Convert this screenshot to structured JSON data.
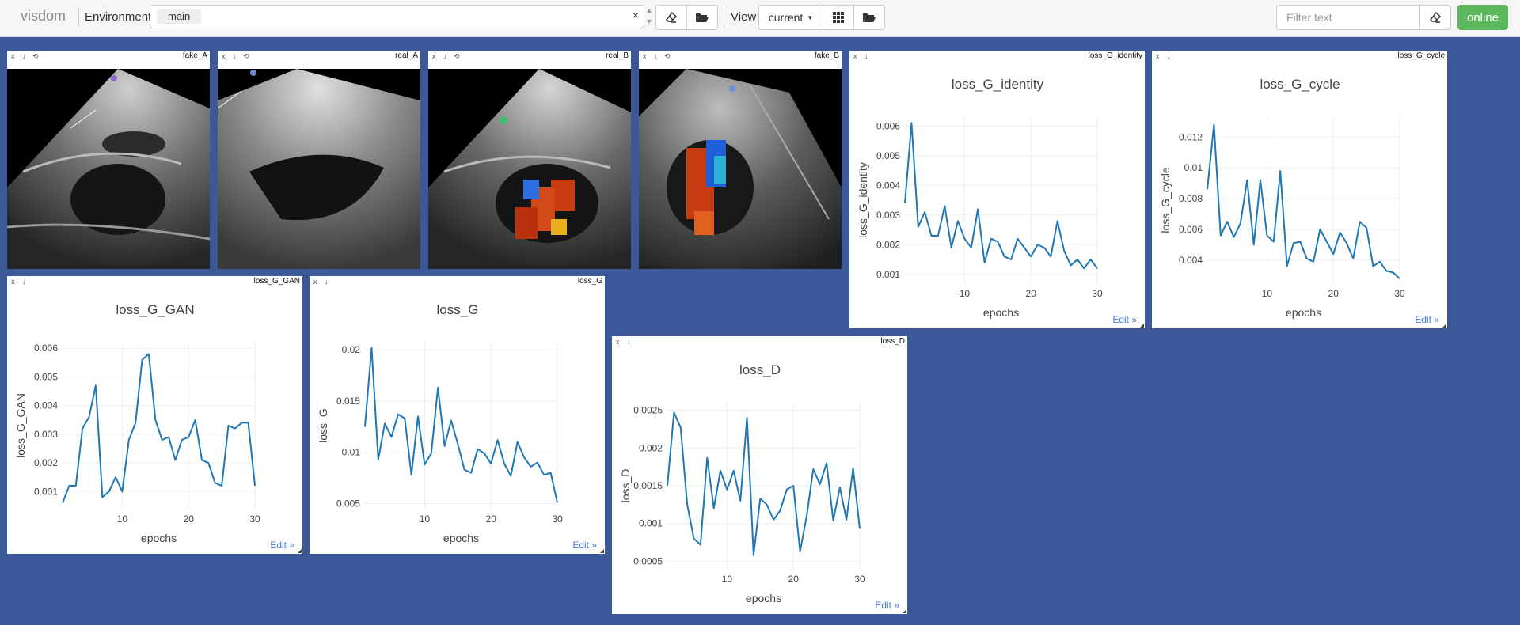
{
  "navbar": {
    "brand": "visdom",
    "environment_label": "Environment",
    "environment_tag": "main",
    "environment_clear": "×",
    "view_label": "View",
    "view_value": "current",
    "filter_placeholder": "Filter text",
    "status": "online",
    "status_color": "#5cb85c"
  },
  "pane_controls": {
    "close": "x",
    "download": "↓",
    "reset": "⟲"
  },
  "image_panes": [
    {
      "title": "fake_A",
      "kind": "grayscale-ultrasound"
    },
    {
      "title": "real_A",
      "kind": "grayscale-ultrasound"
    },
    {
      "title": "real_B",
      "kind": "color-doppler-ultrasound"
    },
    {
      "title": "fake_B",
      "kind": "color-doppler-ultrasound"
    }
  ],
  "edit_label": "Edit »",
  "chart_data": [
    {
      "type": "line",
      "title": "loss_G_identity",
      "xlabel": "epochs",
      "ylabel": "loss_G_identity",
      "line_color": "#1f77b4",
      "x": [
        1,
        2,
        3,
        4,
        5,
        6,
        7,
        8,
        9,
        10,
        11,
        12,
        13,
        14,
        15,
        16,
        17,
        18,
        19,
        20,
        21,
        22,
        23,
        24,
        25,
        26,
        27,
        28,
        29,
        30
      ],
      "y": [
        0.0034,
        0.0061,
        0.0026,
        0.0031,
        0.0023,
        0.0023,
        0.0033,
        0.0019,
        0.0028,
        0.0022,
        0.0019,
        0.0032,
        0.0014,
        0.0022,
        0.0021,
        0.0016,
        0.0015,
        0.0022,
        0.0019,
        0.0016,
        0.002,
        0.0019,
        0.0016,
        0.0028,
        0.0018,
        0.0013,
        0.0015,
        0.0012,
        0.0015,
        0.0012
      ],
      "xticks": [
        10,
        20,
        30
      ],
      "yticks": [
        0.001,
        0.002,
        0.003,
        0.004,
        0.005,
        0.006
      ],
      "ytick_labels": [
        "0.001",
        "0.002",
        "0.003",
        "0.004",
        "0.005",
        "0.006"
      ],
      "xlim": [
        1,
        30
      ],
      "ylim": [
        0.0007,
        0.0063
      ],
      "grid": true
    },
    {
      "type": "line",
      "title": "loss_G_cycle",
      "xlabel": "epochs",
      "ylabel": "loss_G_cycle",
      "line_color": "#1f77b4",
      "x": [
        1,
        2,
        3,
        4,
        5,
        6,
        7,
        8,
        9,
        10,
        11,
        12,
        13,
        14,
        15,
        16,
        17,
        18,
        19,
        20,
        21,
        22,
        23,
        24,
        25,
        26,
        27,
        28,
        29,
        30
      ],
      "y": [
        0.0086,
        0.0128,
        0.0056,
        0.0065,
        0.0055,
        0.0064,
        0.0092,
        0.005,
        0.0092,
        0.0056,
        0.0052,
        0.0098,
        0.0036,
        0.0051,
        0.0052,
        0.0041,
        0.0039,
        0.006,
        0.0052,
        0.0044,
        0.0058,
        0.0051,
        0.0041,
        0.0065,
        0.0061,
        0.0036,
        0.0039,
        0.0033,
        0.0032,
        0.0028
      ],
      "xticks": [
        10,
        20,
        30
      ],
      "yticks": [
        0.004,
        0.006,
        0.008,
        0.01,
        0.012
      ],
      "ytick_labels": [
        "0.004",
        "0.006",
        "0.008",
        "0.01",
        "0.012"
      ],
      "xlim": [
        1,
        30
      ],
      "ylim": [
        0.0025,
        0.0133
      ],
      "grid": true
    },
    {
      "type": "line",
      "title": "loss_G_GAN",
      "xlabel": "epochs",
      "ylabel": "loss_G_GAN",
      "line_color": "#1f77b4",
      "x": [
        1,
        2,
        3,
        4,
        5,
        6,
        7,
        8,
        9,
        10,
        11,
        12,
        13,
        14,
        15,
        16,
        17,
        18,
        19,
        20,
        21,
        22,
        23,
        24,
        25,
        26,
        27,
        28,
        29,
        30
      ],
      "y": [
        0.0006,
        0.0012,
        0.0012,
        0.0032,
        0.0036,
        0.0047,
        0.0008,
        0.001,
        0.0015,
        0.001,
        0.0028,
        0.0034,
        0.0056,
        0.0058,
        0.0035,
        0.0028,
        0.0029,
        0.0021,
        0.0028,
        0.0029,
        0.0035,
        0.0021,
        0.002,
        0.0013,
        0.0012,
        0.0033,
        0.0032,
        0.0034,
        0.0034,
        0.0012
      ],
      "xticks": [
        10,
        20,
        30
      ],
      "yticks": [
        0.001,
        0.002,
        0.003,
        0.004,
        0.005,
        0.006
      ],
      "ytick_labels": [
        "0.001",
        "0.002",
        "0.003",
        "0.004",
        "0.005",
        "0.006"
      ],
      "xlim": [
        1,
        30
      ],
      "ylim": [
        0.0004,
        0.0062
      ],
      "grid": true
    },
    {
      "type": "line",
      "title": "loss_G",
      "xlabel": "epochs",
      "ylabel": "loss_G",
      "line_color": "#1f77b4",
      "x": [
        1,
        2,
        3,
        4,
        5,
        6,
        7,
        8,
        9,
        10,
        11,
        12,
        13,
        14,
        15,
        16,
        17,
        18,
        19,
        20,
        21,
        22,
        23,
        24,
        25,
        26,
        27,
        28,
        29,
        30
      ],
      "y": [
        0.0125,
        0.0202,
        0.0093,
        0.0128,
        0.0115,
        0.0137,
        0.0133,
        0.0078,
        0.0135,
        0.0088,
        0.0099,
        0.0163,
        0.0106,
        0.0131,
        0.0108,
        0.0083,
        0.008,
        0.0103,
        0.0099,
        0.0089,
        0.0112,
        0.0089,
        0.0077,
        0.011,
        0.0095,
        0.0086,
        0.009,
        0.0078,
        0.008,
        0.0051
      ],
      "xticks": [
        10,
        20,
        30
      ],
      "yticks": [
        0.005,
        0.01,
        0.015,
        0.02
      ],
      "ytick_labels": [
        "0.005",
        "0.01",
        "0.015",
        "0.02"
      ],
      "xlim": [
        1,
        30
      ],
      "ylim": [
        0.0045,
        0.0207
      ],
      "grid": true
    },
    {
      "type": "line",
      "title": "loss_D",
      "xlabel": "epochs",
      "ylabel": "loss_D",
      "line_color": "#1f77b4",
      "x": [
        1,
        2,
        3,
        4,
        5,
        6,
        7,
        8,
        9,
        10,
        11,
        12,
        13,
        14,
        15,
        16,
        17,
        18,
        19,
        20,
        21,
        22,
        23,
        24,
        25,
        26,
        27,
        28,
        29,
        30
      ],
      "y": [
        0.0015,
        0.00247,
        0.00227,
        0.00125,
        0.0008,
        0.00072,
        0.00187,
        0.0012,
        0.0017,
        0.00145,
        0.0017,
        0.0013,
        0.0024,
        0.00058,
        0.00133,
        0.00125,
        0.00105,
        0.00117,
        0.00145,
        0.0015,
        0.00063,
        0.0011,
        0.00172,
        0.00152,
        0.0018,
        0.00104,
        0.00148,
        0.00105,
        0.00173,
        0.00093
      ],
      "xticks": [
        10,
        20,
        30
      ],
      "yticks": [
        0.0005,
        0.001,
        0.0015,
        0.002,
        0.0025
      ],
      "ytick_labels": [
        "0.0005",
        "0.001",
        "0.0015",
        "0.002",
        "0.0025"
      ],
      "xlim": [
        1,
        30
      ],
      "ylim": [
        0.0004,
        0.0026
      ],
      "grid": true
    }
  ]
}
